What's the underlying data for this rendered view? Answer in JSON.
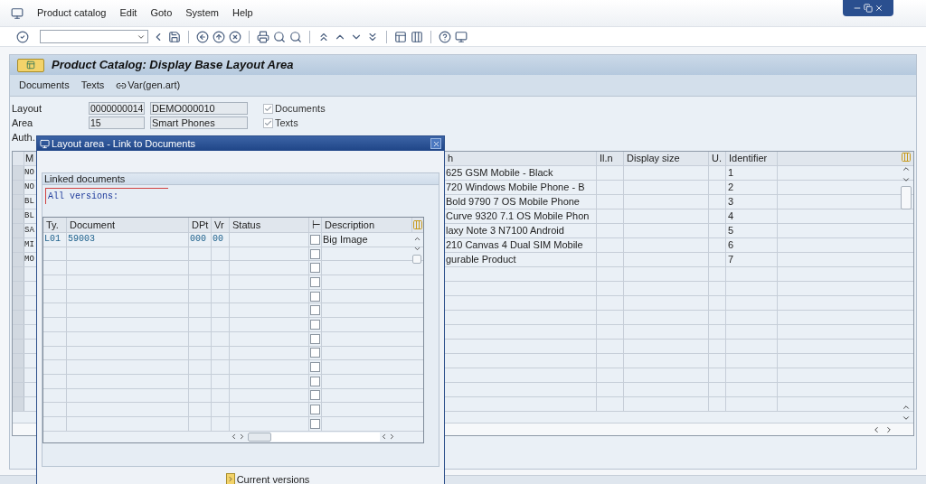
{
  "menu": [
    "Product catalog",
    "Edit",
    "Goto",
    "System",
    "Help"
  ],
  "title": "Product Catalog: Display Base Layout Area",
  "app_toolbar": [
    {
      "kind": "text",
      "label": "Documents"
    },
    {
      "kind": "text",
      "label": "Texts"
    },
    {
      "kind": "icon_text",
      "label": "Var(gen.art)"
    }
  ],
  "form": {
    "rows": [
      {
        "label": "Layout",
        "value": "0000000014",
        "description": "DEMO000010"
      },
      {
        "label": "Area",
        "value": "15",
        "description": "Smart Phones"
      },
      {
        "label": "Auth."
      }
    ],
    "checkboxes": [
      {
        "label": "Documents",
        "checked": true,
        "disabled": true
      },
      {
        "label": "Texts",
        "checked": true,
        "disabled": true
      }
    ]
  },
  "grid": {
    "columns": [
      "M",
      "h",
      "Il.n",
      "Display size",
      "U.",
      "Identifier"
    ],
    "rows": [
      {
        "column_1": "NO",
        "column_2": "625 GSM Mobile - Black",
        "identifier": "1"
      },
      {
        "column_1": "NO",
        "column_2": "720 Windows Mobile Phone - B",
        "identifier": "2"
      },
      {
        "column_1": "BL",
        "column_2": "Bold 9790 7 OS Mobile Phone",
        "identifier": "3"
      },
      {
        "column_1": "BL",
        "column_2": "Curve 9320 7.1 OS Mobile Phon",
        "identifier": "4"
      },
      {
        "column_1": "SA",
        "column_2": "laxy Note 3 N7100 Android",
        "identifier": "5"
      },
      {
        "column_1": "MI",
        "column_2": "210 Canvas 4 Dual SIM Mobile",
        "identifier": "6"
      },
      {
        "column_1": "MO",
        "column_2": "gurable Product",
        "identifier": "7"
      }
    ]
  },
  "dialog": {
    "title": "Layout area - Link to Documents",
    "group_title": "Linked documents",
    "versions_label": "All versions:",
    "columns": [
      "Ty.",
      "Document",
      "DPt",
      "Vr",
      "Status",
      "⊢",
      "Description"
    ],
    "rows": [
      {
        "type": "L01",
        "document": "59003",
        "dpt": "000",
        "vr": "00",
        "checked": false,
        "description": "Big Image"
      },
      {
        "checked": false
      },
      {
        "checked": false
      },
      {
        "checked": false
      },
      {
        "checked": false
      },
      {
        "checked": false
      },
      {
        "checked": false
      },
      {
        "checked": false
      },
      {
        "checked": false
      },
      {
        "checked": false
      },
      {
        "checked": false
      },
      {
        "checked": false
      },
      {
        "checked": false
      },
      {
        "checked": false
      }
    ],
    "button": "Current versions"
  }
}
